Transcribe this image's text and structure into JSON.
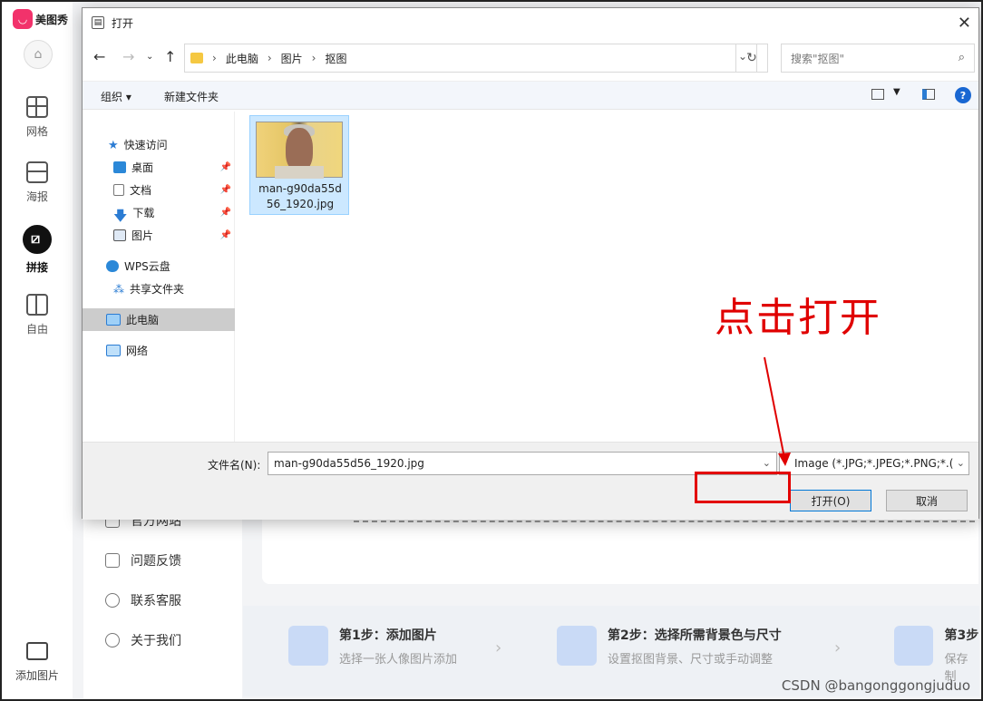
{
  "app": {
    "name": "美图秀",
    "nav": [
      "网格",
      "海报",
      "拼接",
      "自由"
    ],
    "add_picture": "添加图片",
    "menu": [
      "官方网站",
      "问题反馈",
      "联系客服",
      "关于我们"
    ],
    "steps": [
      {
        "title": "第1步：添加图片",
        "desc": "选择一张人像图片添加"
      },
      {
        "title": "第2步：选择所需背景色与尺寸",
        "desc": "设置抠图背景、尺寸或手动调整"
      },
      {
        "title": "第3步",
        "desc": "保存制"
      }
    ]
  },
  "dialog": {
    "title": "打开",
    "breadcrumb": [
      "此电脑",
      "图片",
      "抠图"
    ],
    "search_placeholder": "搜索\"抠图\"",
    "toolbar": {
      "organize": "组织 ▾",
      "new_folder": "新建文件夹"
    },
    "tree": {
      "quick_access": "快速访问",
      "desktop": "桌面",
      "documents": "文档",
      "downloads": "下载",
      "pictures": "图片",
      "wps": "WPS云盘",
      "shared": "共享文件夹",
      "this_pc": "此电脑",
      "network": "网络"
    },
    "file": {
      "name": "man-g90da55d56_1920.jpg",
      "name_line1": "man-g90da55d",
      "name_line2": "56_1920.jpg"
    },
    "filename_label": "文件名(N):",
    "filename_value": "man-g90da55d56_1920.jpg",
    "filter": "Image (*.JPG;*.JPEG;*.PNG;*.(",
    "open_button": "打开(O)",
    "cancel_button": "取消"
  },
  "annotation": {
    "text": "点击打开",
    "color": "#e00000"
  },
  "watermark": "CSDN @bangonggongjuduo"
}
